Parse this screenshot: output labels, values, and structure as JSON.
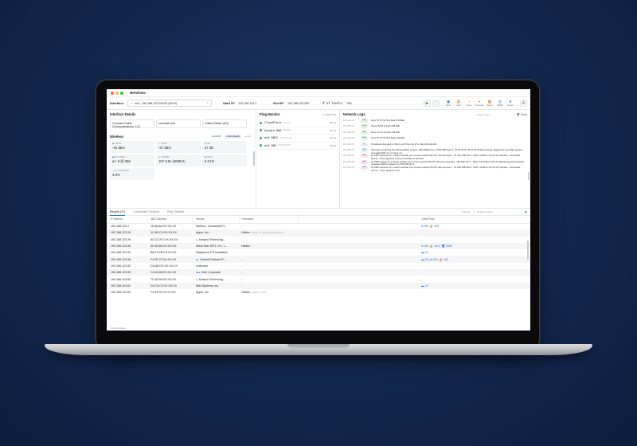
{
  "app": {
    "title": "NetViews"
  },
  "toolbar": {
    "interface_label": "Interface:",
    "interface_value": "en0 - 192.168.123.203/24 (Wi-Fi)",
    "start_ip_label": "Start IP:",
    "start_ip_value": "192.168.123.1",
    "end_ip_label": "End IP:",
    "end_ip_value": "192.168.123.254",
    "hosts_label": "# of hosts:",
    "hosts_value": "254",
    "tools": [
      {
        "icon": "wifi-icon",
        "glyph": "◉",
        "label": "Wi-Fi",
        "color": "#2a72d4"
      },
      {
        "icon": "audit-icon",
        "glyph": "▤",
        "label": "Audit",
        "color": "#e07a1f"
      },
      {
        "icon": "speed-icon",
        "glyph": "◔",
        "label": "Speed",
        "color": "#e07a1f"
      },
      {
        "icon": "traceroute-icon",
        "glyph": "⌖",
        "label": "Traceroute",
        "color": "#e07a1f"
      },
      {
        "icon": "subnet-icon",
        "glyph": "▦",
        "label": "Subnet",
        "color": "#e07a1f"
      },
      {
        "icon": "mdns-icon",
        "glyph": "◎",
        "label": "MDNS",
        "color": "#2a72d4"
      },
      {
        "icon": "routes-icon",
        "glyph": "⋔",
        "label": "Routes",
        "color": "#2a72d4"
      }
    ]
  },
  "interface_details": {
    "title": "Interface Details",
    "provider": "Comcast Cable Communications, LLC",
    "domain": "comcast.com",
    "country": "United States (US)"
  },
  "wireless": {
    "title": "Wireless",
    "find_ap": "Find AP",
    "more_details": "More Details",
    "live": "Live",
    "tiles": [
      {
        "label": "SIGNAL",
        "value": "-45 dBm",
        "icon": "signal-icon",
        "glyph": "◉"
      },
      {
        "label": "NOISE",
        "value": "-97 dBm",
        "icon": "noise-icon",
        "glyph": "∿"
      },
      {
        "label": "SNR",
        "value": "37 dB",
        "icon": "snr-icon",
        "glyph": "▮"
      },
      {
        "label": "MCS INDEX",
        "value": "ac: 9 @ 256",
        "icon": "mcs-icon",
        "glyph": "▣"
      },
      {
        "label": "CHANNEL",
        "value": "157+161 (40MHz)",
        "icon": "channel-icon",
        "glyph": "≋"
      },
      {
        "label": "BAND",
        "value": "5 GHz",
        "icon": "band-icon",
        "glyph": "◧"
      },
      {
        "label": "CH UTILIZATION",
        "value": "3.9%",
        "icon": "utilization-icon",
        "glyph": "◔"
      }
    ]
  },
  "ping_monitor": {
    "title": "Ping Monitor",
    "add_host": "Add Host",
    "hosts": [
      {
        "name": "CloudFlare",
        "ip": "(1.0.0.1)",
        "ms": "34 ms"
      },
      {
        "name": "Google DNS",
        "ip": "(8.8.8.8)",
        "ms": "34 ms"
      },
      {
        "name": "en0 DNS2",
        "ip": "(75.75.76.76)",
        "ms": "24 ms"
      },
      {
        "name": "en0 DNS",
        "ip": "(75.75.75.75)",
        "ms": "16 ms"
      }
    ]
  },
  "network_logs": {
    "title": "Network Logs",
    "search_placeholder": "Search logs...",
    "clear": "Clear",
    "entries": [
      {
        "time": "2/9 11:01:24",
        "tag": "PING",
        "msg": "Host 75.75.76.76 is back ONLINE"
      },
      {
        "time": "2/9 11:01:24",
        "tag": "PING",
        "msg": "Host 8.8.8.8 is back ONLINE"
      },
      {
        "time": "2/9 11:01:24",
        "tag": "PING",
        "msg": "Host 1.0.0.1 is back ONLINE"
      },
      {
        "time": "2/9 11:01:24",
        "tag": "PING",
        "msg": "Host 75.75.75.75 is back ONLINE"
      },
      {
        "time": "2/9 11:01:07",
        "tag": "IP",
        "msg": "IP address changed on Wi-Fi (en0) from No IP to 192.168.123.202"
      },
      {
        "time": "2/9 11:01:07",
        "tag": "DNS",
        "msg": "Currently monitoring the following DNS servers: 2001:558:feed::1, 2001:558:feed::2, 75.75.75.75, 75.75.76.76 Alerts will be triggered for any DNS request exceeding 500 ms or timing out."
      },
      {
        "time": "2/9 11:01:07",
        "tag": "ARP",
        "msg": "An ARP response for a device outside your current network (No IP) was just seen! - IP: 192.168.123.1 - MAC: 10:36:xx:XX:XX:XX (Vantiva - Connected Home) - There appears to be an anomaly on this port."
      },
      {
        "time": "2/9 11:01:07",
        "tag": "ARP",
        "msg": "An ARP request for a device outside your current network (No IP) was just requested - 192.168.123.1 - MAC: 04:14:59:XX:XX:XX (Randomized/Generated) requested ARP resolution for 192.168.123.1"
      },
      {
        "time": "2/9 11:01:07",
        "tag": "ARP",
        "msg": "An ARP response for a device outside your current network (No IP) was just seen! - IP: 192.168.123.1 - MAC: 10:36:xx:XX:XX:XX (Vantiva - Connected Home) - There appears to be"
      }
    ]
  },
  "results": {
    "tabs": [
      {
        "label": "Results (47)"
      },
      {
        "label": "Connection Timeline"
      },
      {
        "label": "Ping Timeline"
      }
    ],
    "export": "Export",
    "search_placeholder": "Search results...",
    "columns": [
      "IP Address",
      "MAC Address",
      "Vendor",
      "Hostname",
      "Open Ports"
    ],
    "rows": [
      {
        "ip": "192.168.123.1",
        "mac": "10:36:AA:XX:XX:XX",
        "vendor": "Vantiva - Connected H...",
        "vendor_icon": "",
        "hostname": "-",
        "note": "",
        "ports": "⊕ 80 | 🔒 443"
      },
      {
        "ip": "192.168.123.26",
        "mac": "1C:B3:C9:XX:XX:XX",
        "vendor": "Apple, Inc.",
        "vendor_icon": "",
        "hostname": "Hidden",
        "note": "Apple TV 4K (2nd generation)",
        "ports": "-"
      },
      {
        "ip": "192.168.123.29",
        "mac": "AC:CC:FC:XX:XX:XX",
        "vendor": "Amazon Technolog...",
        "vendor_icon": "a",
        "hostname": "-",
        "note": "",
        "ports": "-"
      },
      {
        "ip": "192.168.123.30",
        "mac": "6C:62:6D:XX:XX:XX",
        "vendor": "Micro-Star INT'L CO., L...",
        "vendor_icon": "",
        "hostname": "Hidden",
        "note": "",
        "ports": "⊕ 80 | 🔒 443 | 🖥 3389"
      },
      {
        "ip": "192.168.123.33",
        "mac": "B8:27:EB:XX:XX:XX",
        "vendor": "Raspberry Pi Foundation",
        "vendor_icon": "",
        "hostname": "-",
        "note": "",
        "ports": "▬ 22"
      },
      {
        "ip": "192.168.123.38",
        "mac": "F4:2E:7F:XX:XX:XX",
        "vendor": "Hewlett Packard E...",
        "vendor_icon": "hp",
        "hostname": "-",
        "note": "",
        "ports": "▬ 22 | ⊕ 80 | 🔒 443"
      },
      {
        "ip": "192.168.123.52",
        "mac": "D4:AE:DD:XX:XX:XX",
        "vendor": "Unknown",
        "vendor_icon": "",
        "hostname": "-",
        "note": "",
        "ports": "-"
      },
      {
        "ip": "192.168.123.59",
        "mac": "C4:34:6B:XX:XX:XX",
        "vendor": "Intel Corporate",
        "vendor_icon": "intel",
        "hostname": "-",
        "note": "",
        "ports": "-"
      },
      {
        "ip": "192.168.123.60",
        "mac": "7C:63:05:XX:XX:XX",
        "vendor": "Amazon Technolog...",
        "vendor_icon": "a",
        "hostname": "-",
        "note": "",
        "ports": "-"
      },
      {
        "ip": "192.168.123.62",
        "mac": "04:CD:C0:XX:XX:XX",
        "vendor": "Mist Systems, Inc.",
        "vendor_icon": "",
        "hostname": "-",
        "note": "",
        "ports": "▬ 22"
      },
      {
        "ip": "192.168.123.64",
        "mac": "F4:34:F0:XX:XX:XX",
        "vendor": "Apple, Inc.",
        "vendor_icon": "",
        "hostname": "Hidden",
        "note": "Apple TV HD",
        "ports": "-"
      }
    ],
    "status": "Scan complete"
  },
  "colors": {
    "accent": "#1a6ee0",
    "online": "#32b34a",
    "close": "#ff5f57",
    "minimize": "#febc2e",
    "zoom": "#28c840"
  }
}
